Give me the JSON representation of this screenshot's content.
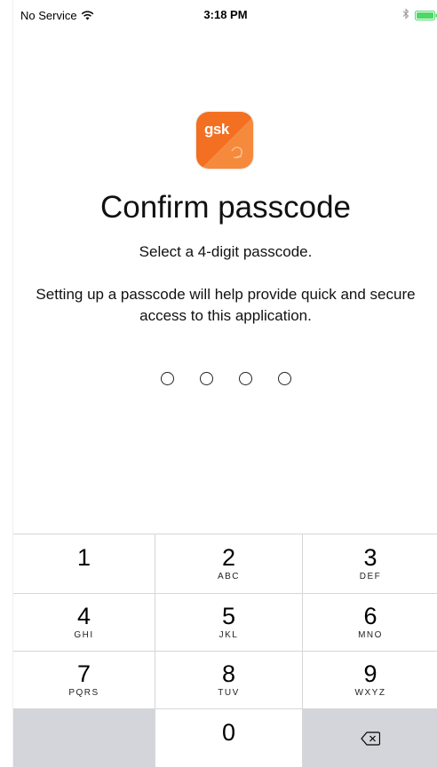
{
  "status_bar": {
    "carrier": "No Service",
    "time": "3:18 PM"
  },
  "logo": {
    "text": "gsk",
    "colors": {
      "primary": "#f36f21",
      "secondary": "#f7a35c"
    }
  },
  "title": "Confirm passcode",
  "subtitle": "Select a 4-digit passcode.",
  "description": "Setting up a passcode will help provide quick and secure access to this application.",
  "passcode_length": 4,
  "keypad": {
    "keys": [
      {
        "digit": "1",
        "letters": ""
      },
      {
        "digit": "2",
        "letters": "ABC"
      },
      {
        "digit": "3",
        "letters": "DEF"
      },
      {
        "digit": "4",
        "letters": "GHI"
      },
      {
        "digit": "5",
        "letters": "JKL"
      },
      {
        "digit": "6",
        "letters": "MNO"
      },
      {
        "digit": "7",
        "letters": "PQRS"
      },
      {
        "digit": "8",
        "letters": "TUV"
      },
      {
        "digit": "9",
        "letters": "WXYZ"
      },
      {
        "digit": "0",
        "letters": ""
      }
    ],
    "delete_icon": "backspace-icon"
  },
  "colors": {
    "keypad_gray": "#d3d5da",
    "battery_green": "#4cd964"
  }
}
